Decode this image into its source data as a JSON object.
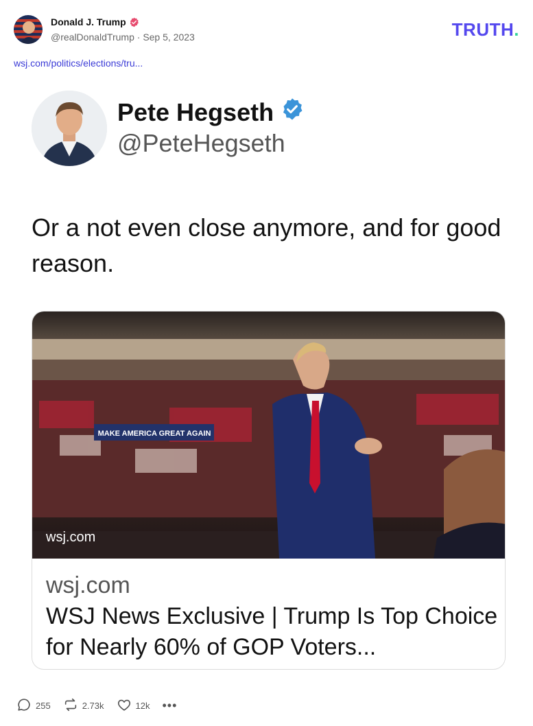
{
  "post": {
    "author_name": "Donald J. Trump",
    "handle": "@realDonaldTrump",
    "separator": "·",
    "date": "Sep 5, 2023",
    "link_text": "wsj.com/politics/elections/tru..."
  },
  "brand": {
    "name": "TRUTH",
    "dot": "."
  },
  "embedded_tweet": {
    "name": "Pete Hegseth",
    "handle": "@PeteHegseth",
    "text": "Or a not even close anymore, and for good reason.",
    "card": {
      "image_banner_text": "MAKE AMERICA GREAT AGAIN",
      "image_overlay_domain": "wsj.com",
      "domain": "wsj.com",
      "title": "WSJ News Exclusive | Trump Is Top Choice for Nearly 60% of GOP Voters..."
    }
  },
  "actions": {
    "replies": "255",
    "retruths": "2.73k",
    "likes": "12k",
    "more": "•••"
  },
  "icons": {
    "verified_red": "verified-badge-icon",
    "verified_blue": "verified-badge-icon",
    "reply": "comment-icon",
    "retruth": "retruth-icon",
    "like": "heart-icon",
    "more": "more-icon"
  },
  "colors": {
    "brand": "#5448ee",
    "brand_dot": "#34d399",
    "link": "#3a3ad6",
    "verified_red": "#e74c6f",
    "verified_blue": "#3b94d9"
  }
}
